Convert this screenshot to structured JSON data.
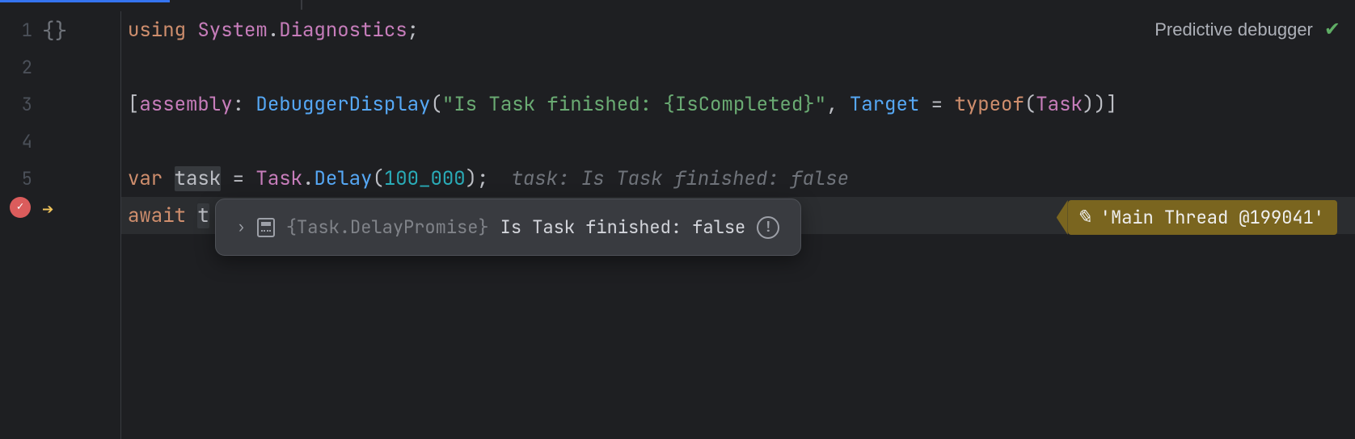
{
  "header": {
    "predictive_label": "Predictive debugger"
  },
  "gutter": {
    "lines": [
      "1",
      "2",
      "3",
      "4",
      "5"
    ],
    "braces_glyph": "{}",
    "arrow_glyph": "➔",
    "breakpoint_check": "✓"
  },
  "code": {
    "line1": {
      "using": "using",
      "namespace_a": "System",
      "dot": ".",
      "namespace_b": "Diagnostics",
      "semi": ";"
    },
    "line3": {
      "open": "[",
      "assembly": "assembly",
      "colon": ": ",
      "attr_name": "DebuggerDisplay",
      "paren_open": "(",
      "string": "\"Is Task finished: {IsCompleted}\"",
      "comma": ", ",
      "target": "Target",
      "eq": " = ",
      "typeof": "typeof",
      "paren2": "(",
      "task": "Task",
      "close": "))]"
    },
    "line5": {
      "var": "var",
      "sp1": " ",
      "task_var": "task",
      "eq": " = ",
      "task_type": "Task",
      "dot": ".",
      "delay": "Delay",
      "paren_open": "(",
      "num": "100_000",
      "close": ");",
      "hint": "task: Is Task finished: false"
    },
    "line6": {
      "await": "await",
      "sp": " ",
      "t": "t"
    }
  },
  "tooltip": {
    "chevron": "›",
    "type_label": "{Task.DelayPromise}",
    "value_label": "Is Task finished: false",
    "alert": "!"
  },
  "thread": {
    "squiggle": "✎",
    "label": "'Main Thread @199041'"
  }
}
